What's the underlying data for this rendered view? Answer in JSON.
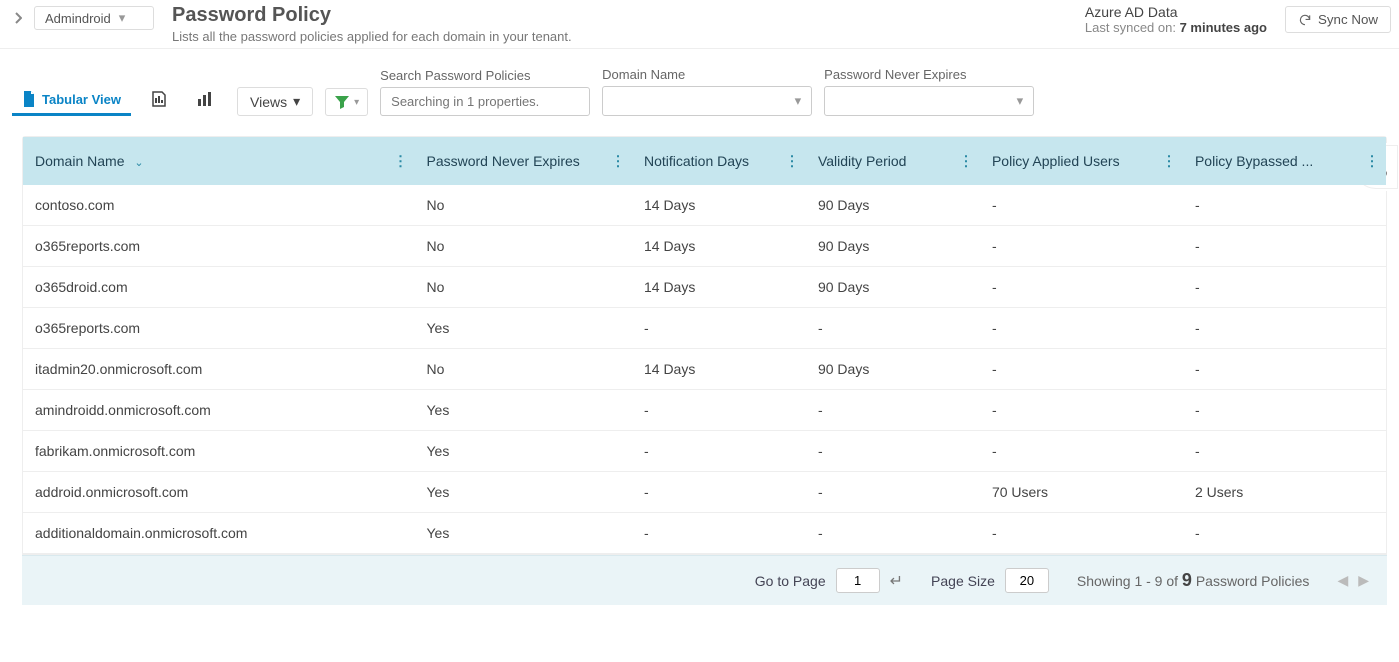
{
  "header": {
    "tenant": "Admindroid",
    "title": "Password Policy",
    "subtitle": "Lists all the password policies applied for each domain in your tenant.",
    "sync_source": "Azure AD Data",
    "sync_prefix": "Last synced on: ",
    "sync_time": "7 minutes ago",
    "sync_button": "Sync Now"
  },
  "toolbar": {
    "tab_tabular": "Tabular View",
    "views_label": "Views",
    "search_label": "Search Password Policies",
    "search_placeholder": "Searching in 1 properties.",
    "filter1_label": "Domain Name",
    "filter2_label": "Password Never Expires"
  },
  "columns": {
    "c1": "Domain Name",
    "c2": "Password Never Expires",
    "c3": "Notification Days",
    "c4": "Validity Period",
    "c5": "Policy Applied Users",
    "c6": "Policy Bypassed ..."
  },
  "rows": [
    {
      "domain": "contoso.com",
      "expires": "No",
      "notify": "14 Days",
      "validity": "90 Days",
      "applied": "-",
      "bypassed": "-"
    },
    {
      "domain": "o365reports.com",
      "expires": "No",
      "notify": "14 Days",
      "validity": "90 Days",
      "applied": "-",
      "bypassed": "-"
    },
    {
      "domain": "o365droid.com",
      "expires": "No",
      "notify": "14 Days",
      "validity": "90 Days",
      "applied": "-",
      "bypassed": "-"
    },
    {
      "domain": "o365reports.com",
      "expires": "Yes",
      "notify": "-",
      "validity": "-",
      "applied": "-",
      "bypassed": "-"
    },
    {
      "domain": "itadmin20.onmicrosoft.com",
      "expires": "No",
      "notify": "14 Days",
      "validity": "90 Days",
      "applied": "-",
      "bypassed": "-"
    },
    {
      "domain": "amindroidd.onmicrosoft.com",
      "expires": "Yes",
      "notify": "-",
      "validity": "-",
      "applied": "-",
      "bypassed": "-"
    },
    {
      "domain": "fabrikam.onmicrosoft.com",
      "expires": "Yes",
      "notify": "-",
      "validity": "-",
      "applied": "-",
      "bypassed": "-"
    },
    {
      "domain": "addroid.onmicrosoft.com",
      "expires": "Yes",
      "notify": "-",
      "validity": "-",
      "applied": "70 Users",
      "bypassed": "2 Users"
    },
    {
      "domain": "additionaldomain.onmicrosoft.com",
      "expires": "Yes",
      "notify": "-",
      "validity": "-",
      "applied": "-",
      "bypassed": "-"
    }
  ],
  "footer": {
    "goto_label": "Go to Page",
    "goto_value": "1",
    "psize_label": "Page Size",
    "psize_value": "20",
    "summary_prefix": "Showing 1 - 9 of ",
    "summary_total": "9",
    "summary_suffix": " Password Policies"
  }
}
